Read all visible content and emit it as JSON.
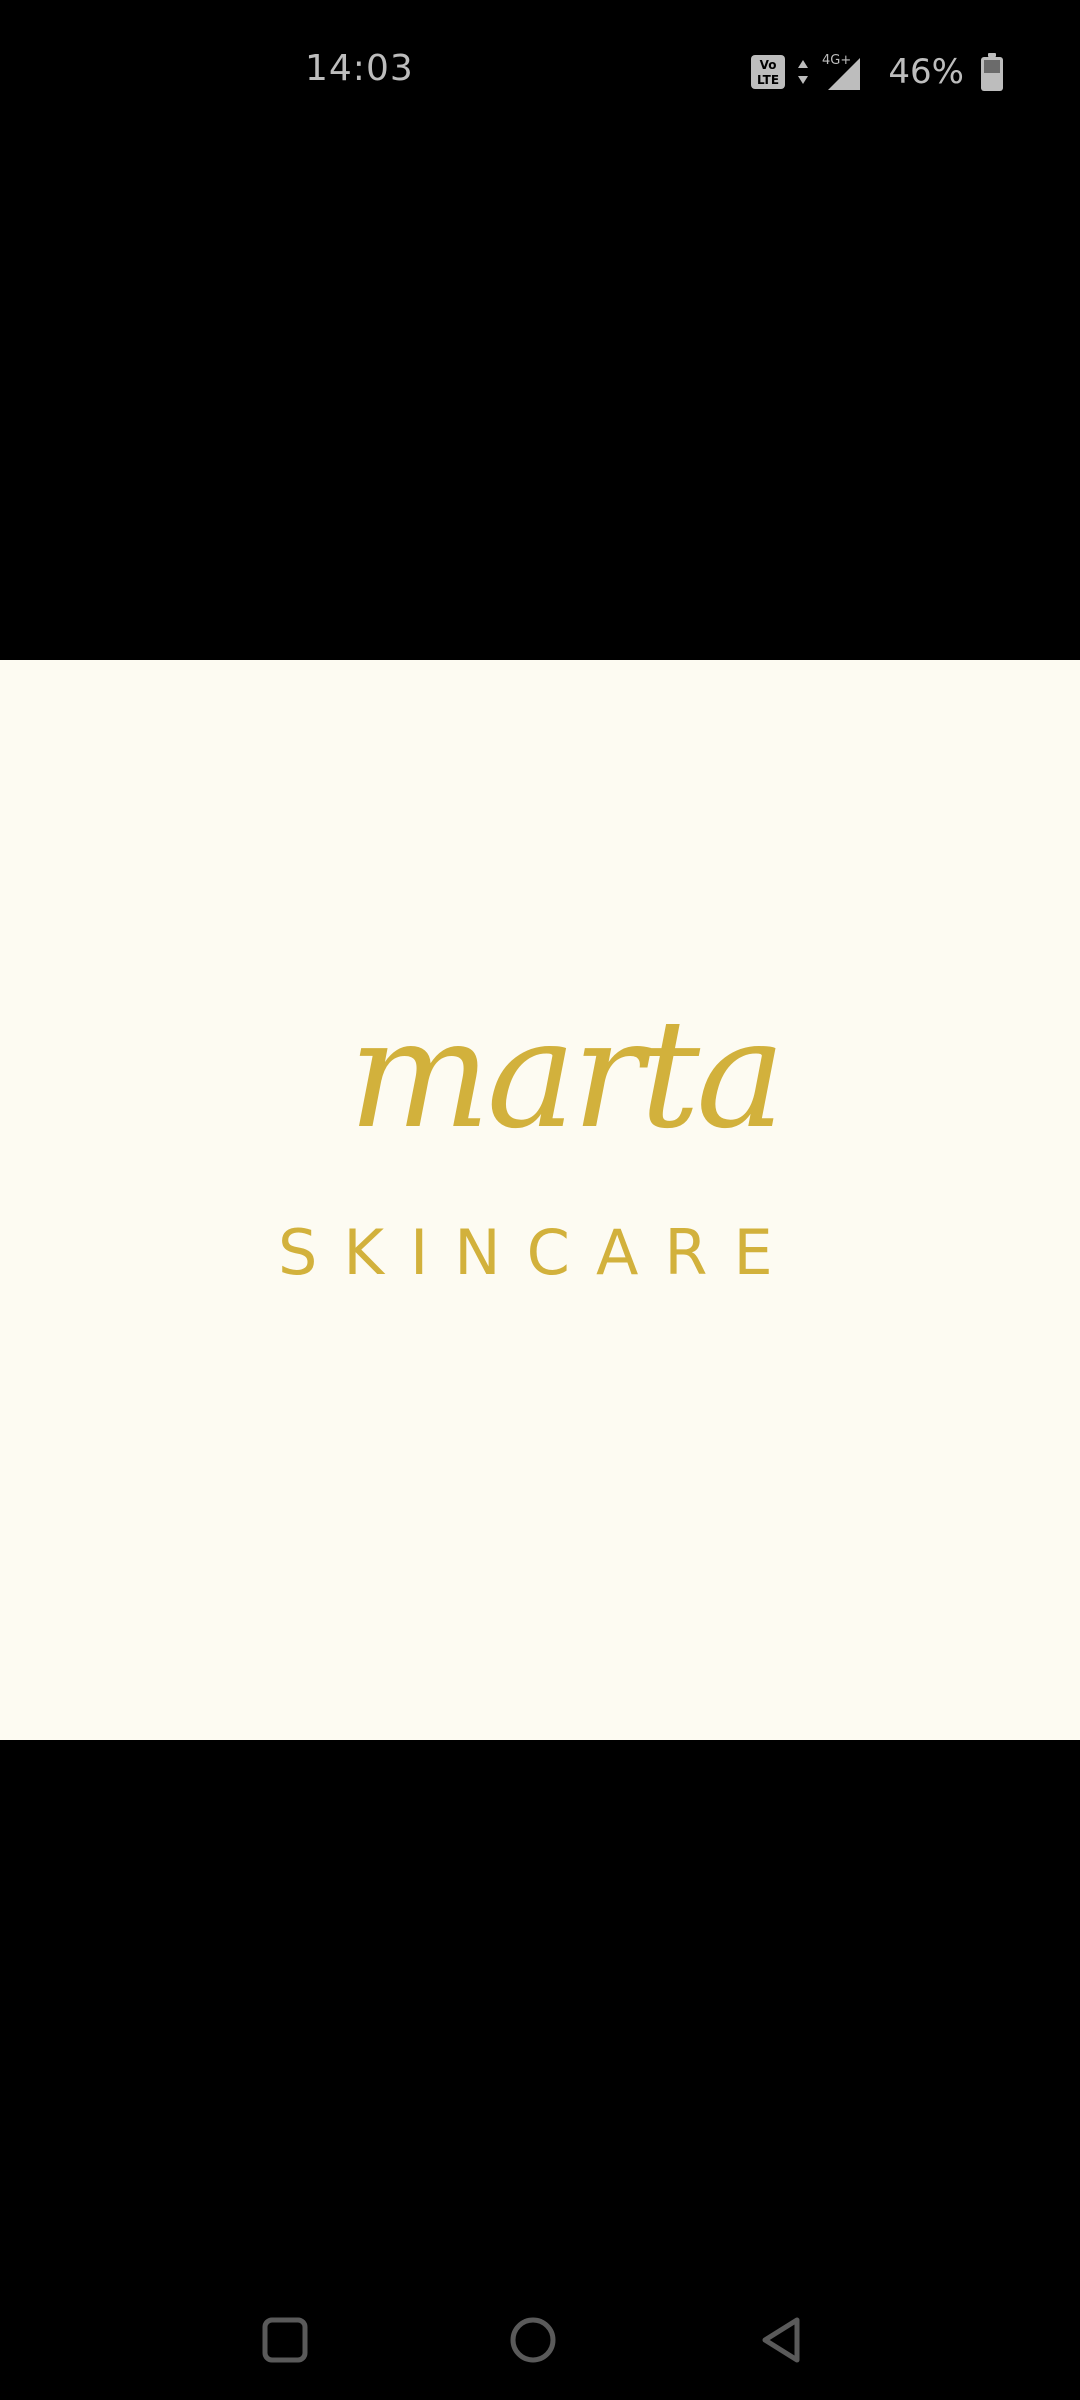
{
  "status_bar": {
    "time": "14:03",
    "network_badge": "Vo LTE",
    "network_type": "4G+",
    "battery_percent": "46%",
    "icons": [
      "volte-icon",
      "data-arrows-icon",
      "signal-icon",
      "battery-icon"
    ]
  },
  "image": {
    "background_color": "#fdfbf2",
    "brand_script": "marta",
    "brand_sub": "SKINCARE",
    "brand_color": "#d2b13c"
  },
  "nav_bar": {
    "icons": [
      "recents-icon",
      "home-icon",
      "back-icon"
    ]
  }
}
